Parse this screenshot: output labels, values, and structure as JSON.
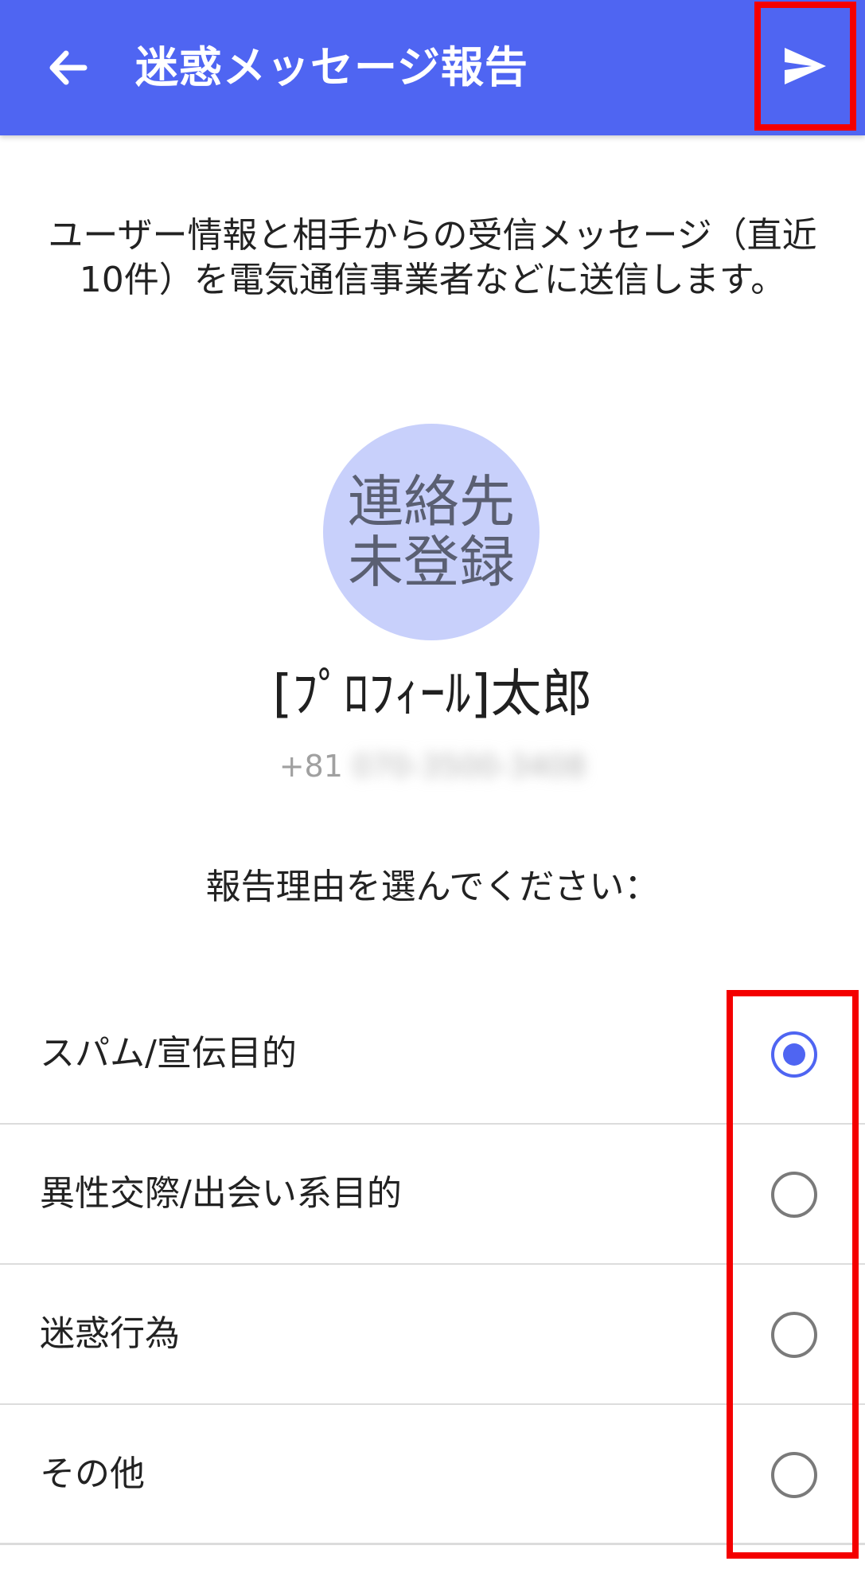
{
  "app_bar": {
    "title": "迷惑メッセージ報告",
    "back_icon": "arrow-left-icon",
    "send_icon": "send-icon",
    "background_color": "#4f65f2"
  },
  "description": "ユーザー情報と相手からの受信メッセージ（直近10件）を電気通信事業者などに送信します。",
  "contact": {
    "avatar_line1": "連絡先",
    "avatar_line2": "未登録",
    "name": "[ﾌﾟﾛﾌｨｰﾙ]太郎",
    "phone_prefix": "+81",
    "phone_number": "070-3500-3408"
  },
  "prompt": "報告理由を選んでください：",
  "options": [
    {
      "label": "スパム/宣伝目的",
      "selected": true
    },
    {
      "label": "異性交際/出会い系目的",
      "selected": false
    },
    {
      "label": "迷惑行為",
      "selected": false
    },
    {
      "label": "その他",
      "selected": false
    }
  ],
  "highlight_color": "#f40000"
}
